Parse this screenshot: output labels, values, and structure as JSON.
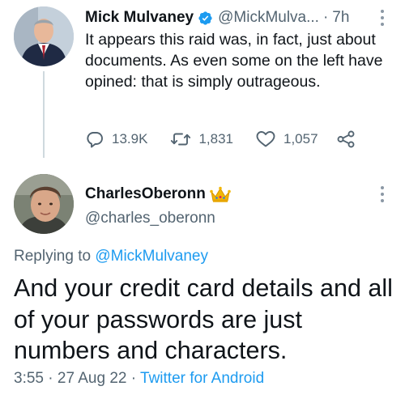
{
  "colors": {
    "text": "#0f1419",
    "secondary": "#536471",
    "link": "#1d9bf0",
    "thread_line": "#cfd9de"
  },
  "parent_tweet": {
    "author_name": "Mick Mulvaney",
    "verified": true,
    "handle": "@MickMulva...",
    "separator": "·",
    "time": "7h",
    "text": "It appears this raid was, in fact, just about documents.  As even some on the left have opined: that is simply outrageous.",
    "actions": {
      "replies": "13.9K",
      "retweets": "1,831",
      "likes": "1,057"
    }
  },
  "reply_tweet": {
    "author_name": "CharlesOberonn",
    "name_badge_icon": "crown-icon",
    "handle": "@charles_oberonn",
    "replying_prefix": "Replying to",
    "replying_to": "@MickMulvaney",
    "text": "And your credit card details and all of your passwords are just numbers and characters.",
    "time": "3:55",
    "separator1": "·",
    "date": "27 Aug 22",
    "separator2": "·",
    "source": "Twitter for Android"
  }
}
